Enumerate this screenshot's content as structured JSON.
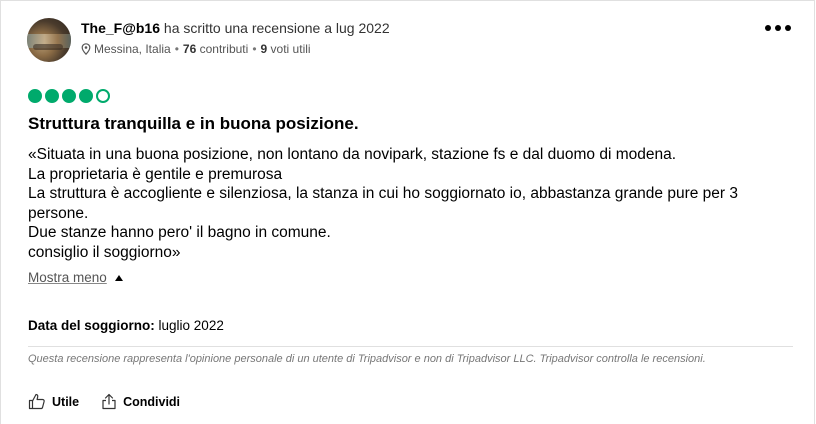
{
  "reviewer": {
    "username": "The_F@b16",
    "action_text": "ha scritto una recensione a lug 2022",
    "location": "Messina, Italia",
    "contributions": "76",
    "contributions_label": "contributi",
    "votes": "9",
    "votes_label": "voti utili"
  },
  "rating": {
    "value": 4,
    "max": 5,
    "color": "#00aa6c"
  },
  "review": {
    "title": "Struttura tranquilla e in buona posizione.",
    "lines": [
      "«Situata in una buona posizione, non lontano da novipark, stazione fs e dal duomo di modena.",
      "La proprietaria è gentile e premurosa",
      "La struttura è accogliente e silenziosa, la stanza in cui ho soggiornato io, abbastanza grande pure per 3",
      "persone.",
      "Due stanze hanno pero' il bagno in comune.",
      "consiglio il soggiorno»"
    ],
    "show_less_label": "Mostra meno"
  },
  "stay": {
    "label": "Data del soggiorno:",
    "value": "luglio 2022"
  },
  "disclaimer": "Questa recensione rappresenta l'opinione personale di un utente di Tripadvisor e non di Tripadvisor LLC. Tripadvisor controlla le recensioni.",
  "actions": {
    "helpful_label": "Utile",
    "share_label": "Condividi"
  },
  "icons": {
    "location": "map-pin-icon",
    "more": "more-options-icon",
    "helpful": "thumbs-up-icon",
    "share": "share-icon",
    "caret": "caret-up-icon"
  }
}
